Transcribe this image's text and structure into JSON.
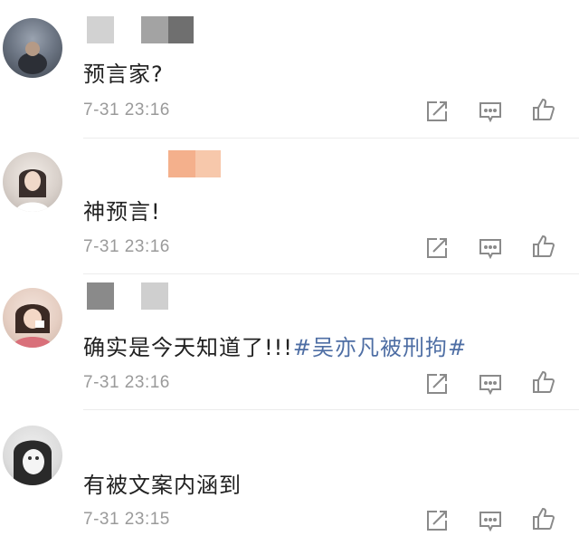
{
  "comments": [
    {
      "text": "预言家?",
      "hashtag": "",
      "time": "7-31 23:16",
      "name_colors": [
        "#d2d2d2",
        "#9e9e9e",
        "#6f6f6f"
      ]
    },
    {
      "text": "神预言!",
      "hashtag": "",
      "time": "7-31 23:16",
      "name_colors": [
        "#f4b08c",
        "#f6c6a8"
      ]
    },
    {
      "text": "确实是今天知道了!!!",
      "hashtag": "#吴亦凡被刑拘#",
      "time": "7-31 23:16",
      "name_colors": [
        "#8a8a8a",
        "#cfcfcf"
      ]
    },
    {
      "text": "有被文案内涵到",
      "hashtag": "",
      "time": "7-31 23:15",
      "name_colors": []
    }
  ],
  "icons": [
    "share-icon",
    "comment-icon",
    "like-icon"
  ],
  "colors": {
    "text": "#222222",
    "time": "#9a9a9a",
    "hashtag": "#4e6ea4",
    "icon": "#8a8a8a"
  }
}
